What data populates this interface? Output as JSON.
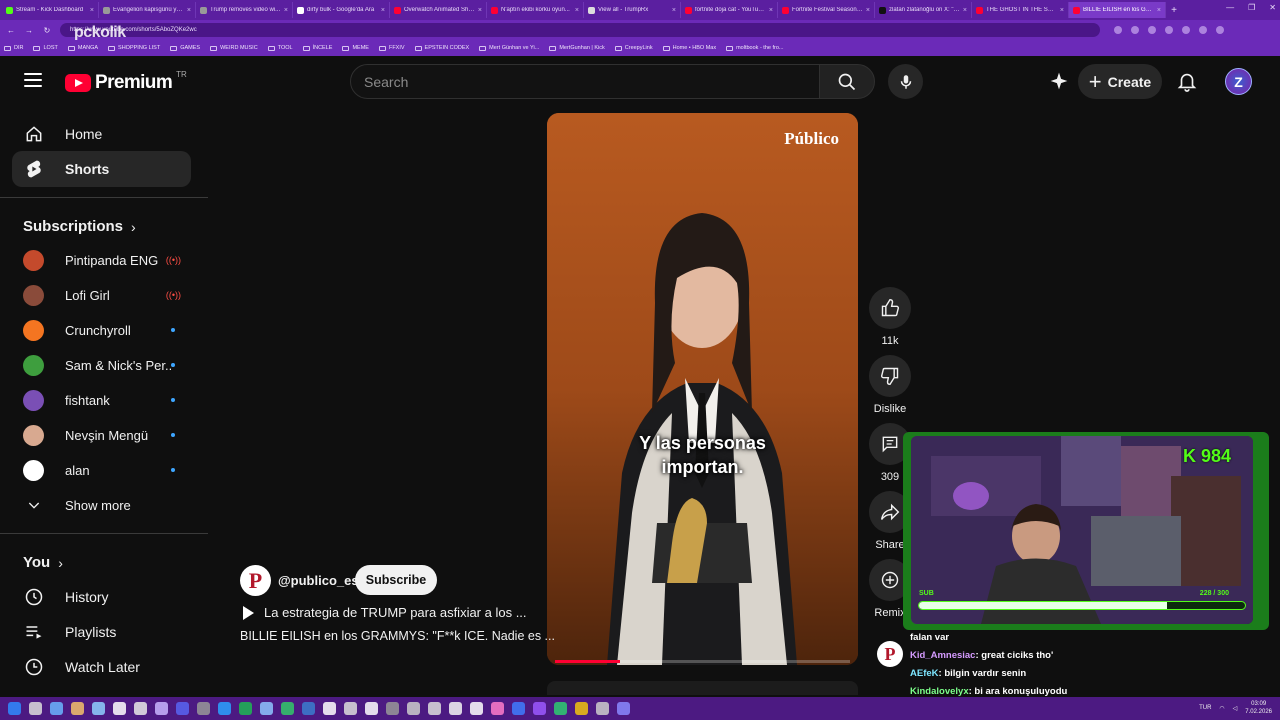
{
  "browser": {
    "tabs": [
      {
        "title": "Stream - Kick Dashboard",
        "fav": "#53fc18"
      },
      {
        "title": "Evangelion kapisgünü yer...",
        "fav": "#999999"
      },
      {
        "title": "Trump removes video wi...",
        "fav": "#999999"
      },
      {
        "title": "dirty bulk - Google'da Ara",
        "fav": "#ffffff"
      },
      {
        "title": "Overwatch Animated Sho...",
        "fav": "#ff0033"
      },
      {
        "title": "N'aptın ekibi korku oyun...",
        "fav": "#ff0033"
      },
      {
        "title": "View all - TrumpRx",
        "fav": "#dddddd"
      },
      {
        "title": "fortnite doja cat - YouTub...",
        "fav": "#ff0033"
      },
      {
        "title": "Fortnite Festival Season 1...",
        "fav": "#ff0033"
      },
      {
        "title": "zlatan zlatanoğlu on X: \"s...",
        "fav": "#111111"
      },
      {
        "title": "THE GHOST IN THE SHELL...",
        "fav": "#ff0033"
      },
      {
        "title": "BILLIE EILISH en los GRA...",
        "fav": "#ff0033"
      }
    ],
    "new_tab": "+",
    "window_controls": [
      "—",
      "❐",
      "✕"
    ],
    "url": "https://www.youtube.com/shorts/5AboZQKe2wc",
    "watermark": "pckolik",
    "bookmarks": [
      "DIR",
      "LOST",
      "MANGA",
      "SHOPPING LIST",
      "GAMES",
      "WEIRD MUSIC",
      "TOOL",
      "İNCELE",
      "MEME",
      "FFXIV",
      "EPSTEIN CODEX",
      "Mert Günhan ve Yi...",
      "MertGunhan | Kick",
      "CreepyLink",
      "Home • HBO Max",
      "moltbook - the fro..."
    ]
  },
  "header": {
    "logo_text": "Premium",
    "region": "TR",
    "search_placeholder": "Search",
    "create_label": "Create",
    "avatar_letter": "Z"
  },
  "sidebar": {
    "main": [
      {
        "label": "Home",
        "icon": "home-icon"
      },
      {
        "label": "Shorts",
        "icon": "shorts-icon"
      }
    ],
    "subscriptions_title": "Subscriptions",
    "subscriptions": [
      {
        "name": "Pintipanda ENG",
        "status": "live",
        "color": "#c44a2c"
      },
      {
        "name": "Lofi Girl",
        "status": "live",
        "color": "#8a4b3a"
      },
      {
        "name": "Crunchyroll",
        "status": "new",
        "color": "#f47521"
      },
      {
        "name": "Sam & Nick's Per...",
        "status": "new",
        "color": "#3e9e3e"
      },
      {
        "name": "fishtank",
        "status": "new",
        "color": "#7a4fb5"
      },
      {
        "name": "Nevşin Mengü",
        "status": "new",
        "color": "#d8a990"
      },
      {
        "name": "alan",
        "status": "new",
        "color": "#ffffff"
      }
    ],
    "show_more": "Show more",
    "you_title": "You",
    "you_items": [
      {
        "label": "History",
        "icon": "history-icon"
      },
      {
        "label": "Playlists",
        "icon": "playlists-icon"
      },
      {
        "label": "Watch Later",
        "icon": "watch-later-icon"
      }
    ]
  },
  "short": {
    "brand": "Público",
    "caption_line1": "Y las personas",
    "caption_line2": "importan.",
    "progress": 0.22,
    "channel_handle": "@publico_es",
    "subscribe_label": "Subscribe",
    "playlist_title": "La estrategia de TRUMP para asfixiar a los ...",
    "title": "BILLIE EILISH en los GRAMMYS: \"F**k ICE. Nadie es ..."
  },
  "actions": [
    {
      "label": "11k",
      "icon": "like-icon"
    },
    {
      "label": "Dislike",
      "icon": "dislike-icon"
    },
    {
      "label": "309",
      "icon": "comment-icon"
    },
    {
      "label": "Share",
      "icon": "share-icon"
    },
    {
      "label": "Remix",
      "icon": "remix-icon"
    }
  ],
  "stream": {
    "kick_count": "K 984",
    "sub_label": "SUB",
    "sub_current": 228,
    "sub_goal": 300,
    "sub_text": "228 / 300"
  },
  "chat": [
    {
      "user": "",
      "message": "falan var",
      "color": "#ffffff"
    },
    {
      "user": "Kid_Amnesiac",
      "message": ": great ciciks tho'",
      "color": "#d59bff"
    },
    {
      "user": "AEfeK",
      "message": ": bilgin vardır senin",
      "color": "#7ee6ff"
    },
    {
      "user": "Kindalovelyx",
      "message": ": bi ara konuşuluyodu",
      "color": "#7cff8a"
    }
  ],
  "taskbar": {
    "lang": "TUR",
    "time": "03:09",
    "date": "7.02.2026"
  }
}
